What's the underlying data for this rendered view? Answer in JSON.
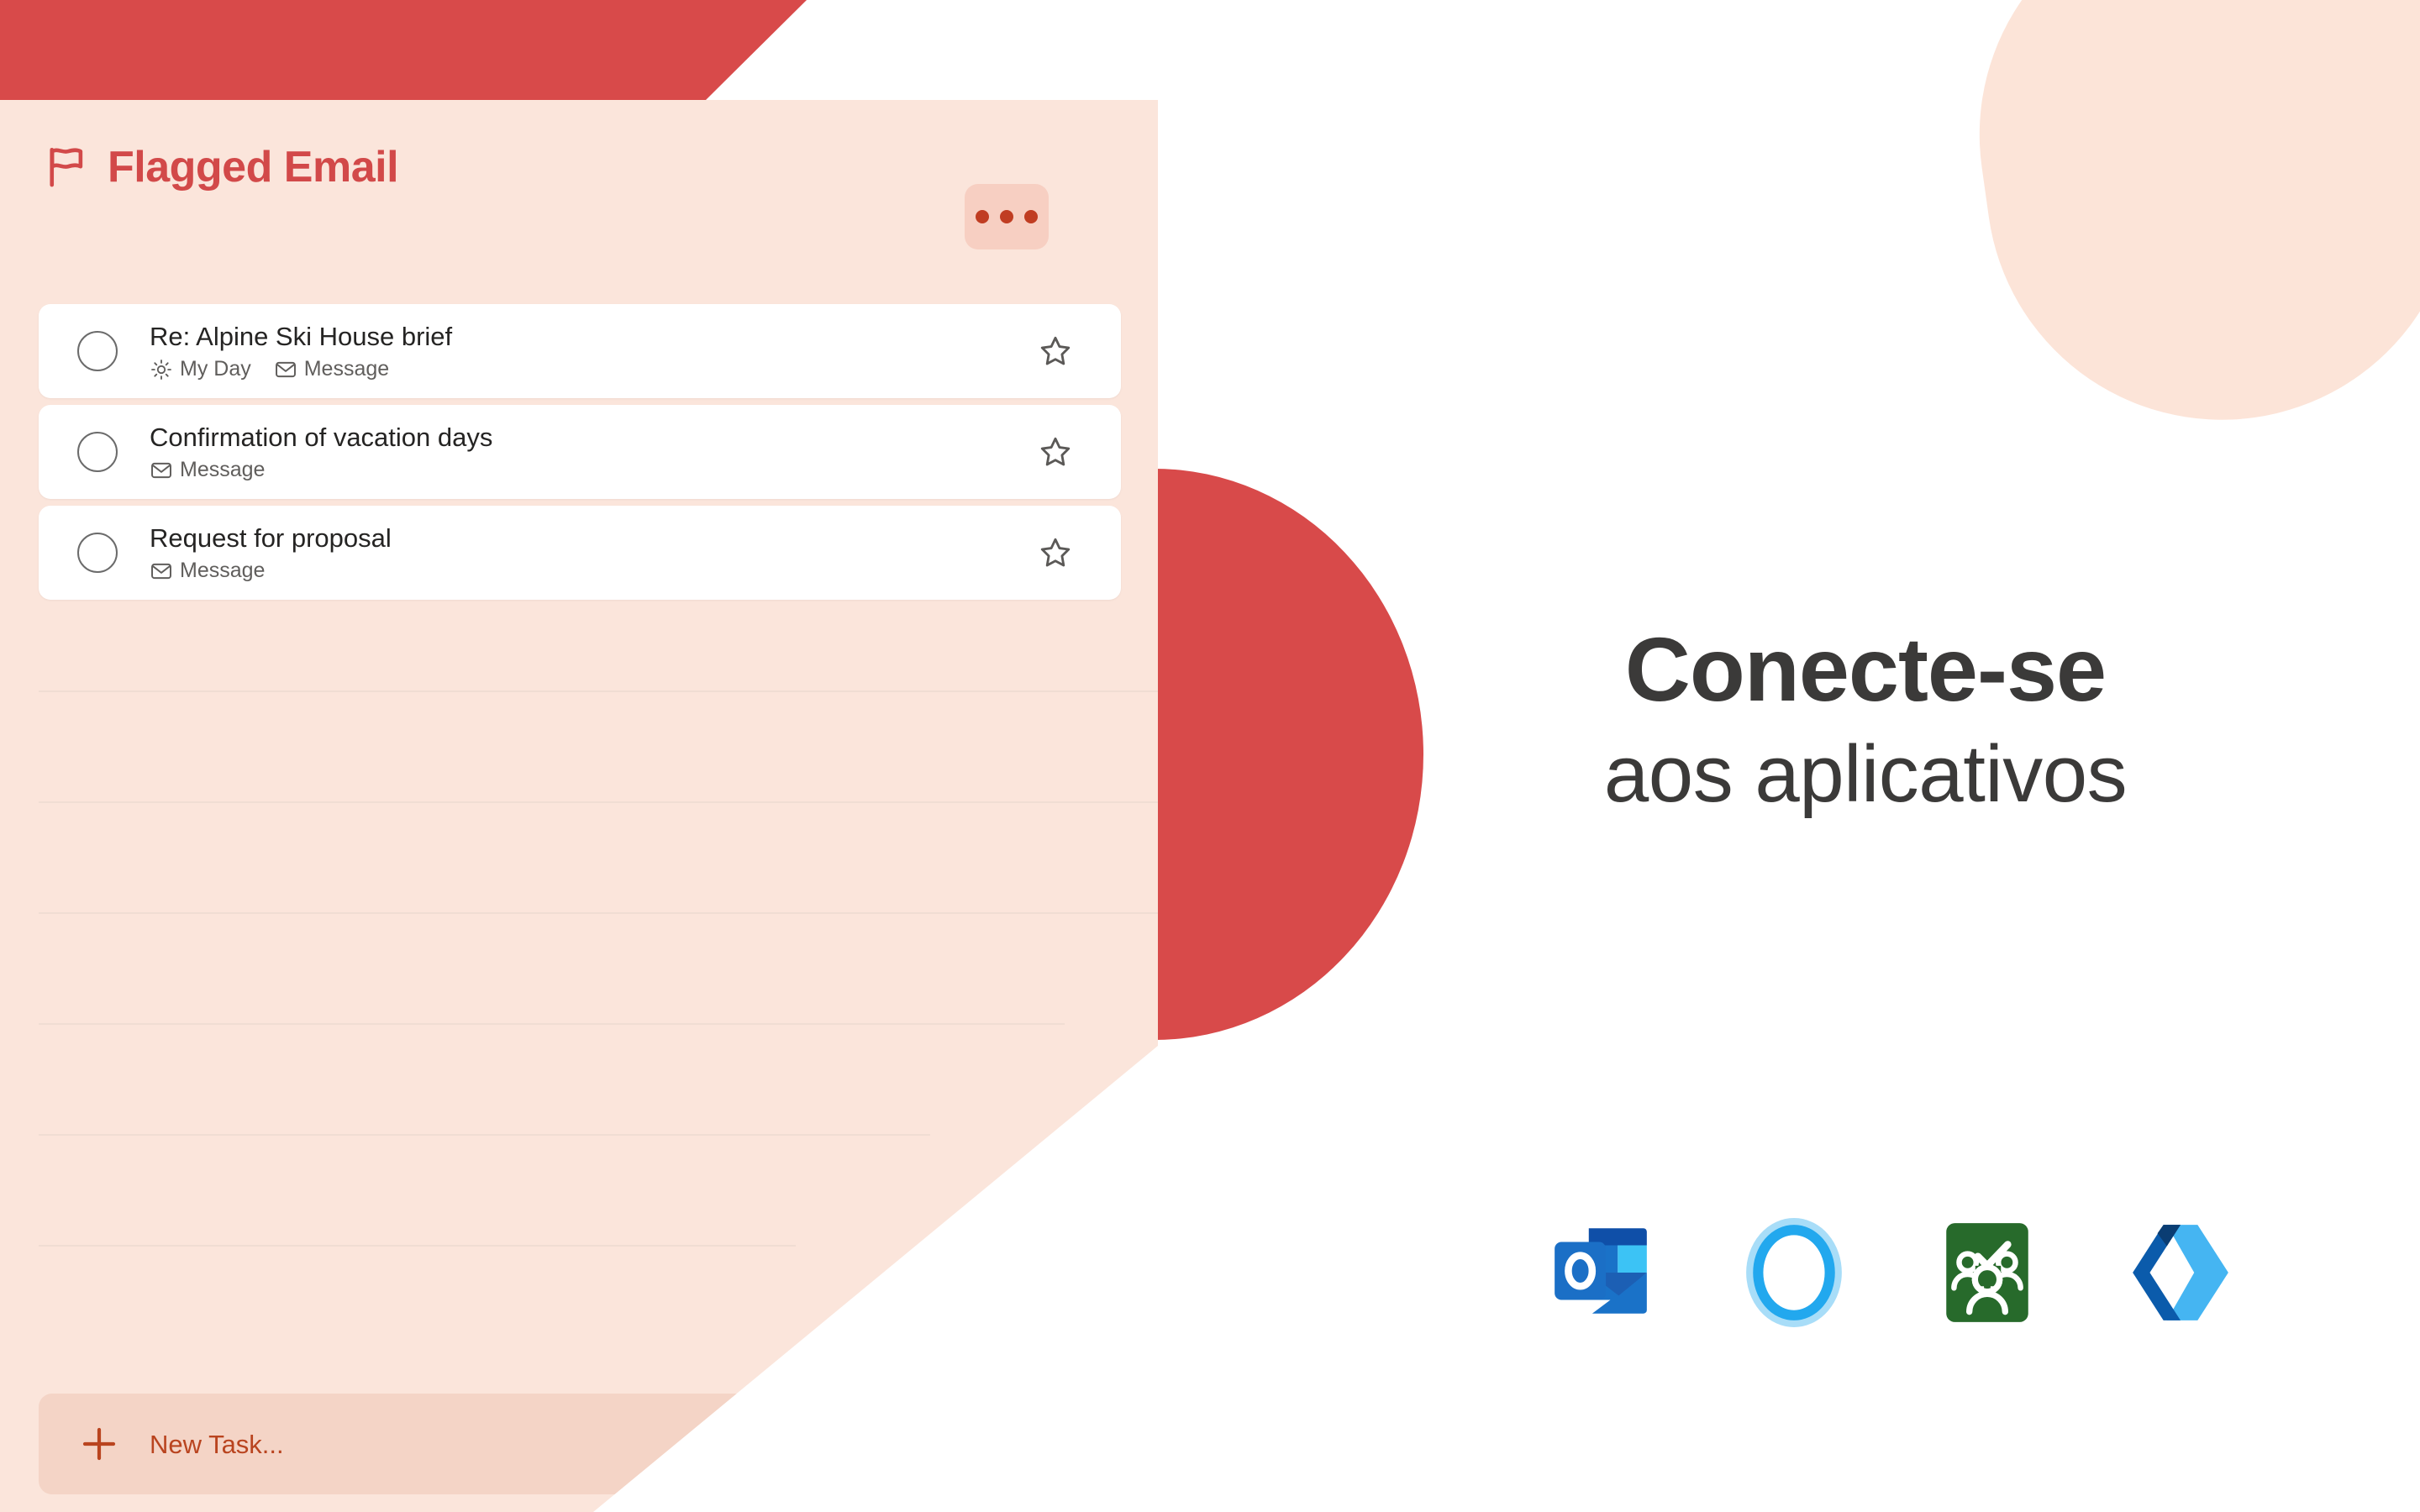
{
  "colors": {
    "brand_red": "#d84a4a",
    "card_bg": "#fbe5db",
    "title_red": "#d24949",
    "new_task_bg": "#f4d4c6",
    "new_task_text": "#b9441f",
    "headline_text": "#3b3a39",
    "peach_blob": "#fce4d8"
  },
  "card": {
    "title": "Flagged Email",
    "flag_icon": "flag-icon",
    "more_button_label": "•••",
    "more_button_icon": "ellipsis-icon",
    "tasks": [
      {
        "title": "Re: Alpine Ski House brief",
        "meta": [
          {
            "icon": "sun-icon",
            "label": "My Day"
          },
          {
            "icon": "envelope-icon",
            "label": "Message"
          }
        ],
        "checkbox_icon": "circle-checkbox-icon",
        "star_icon": "star-outline-icon"
      },
      {
        "title": "Confirmation of vacation days",
        "meta": [
          {
            "icon": "envelope-icon",
            "label": "Message"
          }
        ],
        "checkbox_icon": "circle-checkbox-icon",
        "star_icon": "star-outline-icon"
      },
      {
        "title": "Request for proposal",
        "meta": [
          {
            "icon": "envelope-icon",
            "label": "Message"
          }
        ],
        "checkbox_icon": "circle-checkbox-icon",
        "star_icon": "star-outline-icon"
      }
    ],
    "new_task": {
      "label": "New Task...",
      "icon": "plus-icon"
    },
    "rule_lines": [
      703,
      835,
      967,
      1099,
      1231,
      1363
    ]
  },
  "promo": {
    "headline_strong": "Conecte-se",
    "headline_light": "aos aplicativos",
    "apps": [
      {
        "name": "outlook-icon",
        "label": "Outlook"
      },
      {
        "name": "cortana-icon",
        "label": "Cortana"
      },
      {
        "name": "planner-icon",
        "label": "Planner"
      },
      {
        "name": "power-automate-icon",
        "label": "Power Automate"
      }
    ]
  }
}
